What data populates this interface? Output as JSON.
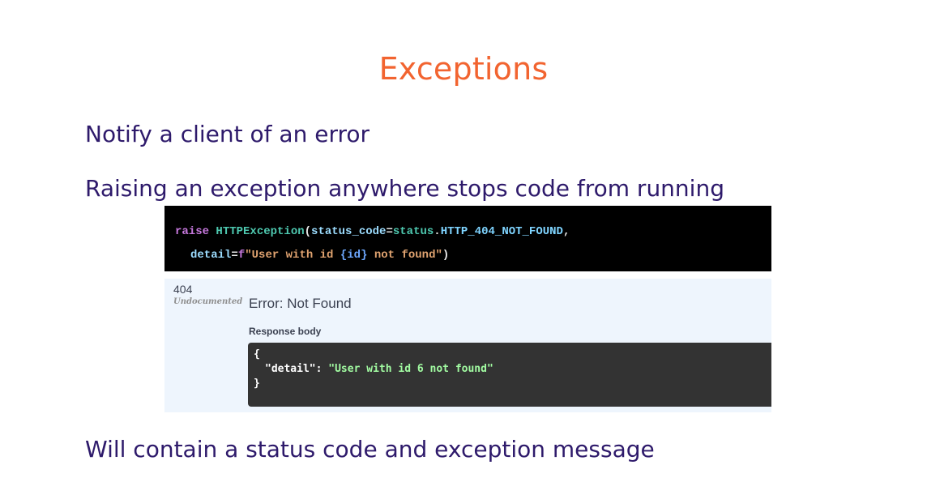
{
  "slide": {
    "title": "Exceptions",
    "bullets": [
      "Notify a client of an error",
      "Raising an exception anywhere stops code from running",
      "Will contain a status code and exception message"
    ]
  },
  "code": {
    "line1": {
      "keyword": "raise",
      "class_name": "HTTPException",
      "open_paren": "(",
      "param": "status_code",
      "equals": "=",
      "module": "status",
      "dot": ".",
      "constant": "HTTP_404_NOT_FOUND",
      "comma": ","
    },
    "line2": {
      "param": "detail",
      "equals": "=",
      "prefix": "f",
      "str_start": "\"User with id ",
      "interp": "{id}",
      "str_end": " not found\"",
      "close_paren": ")"
    }
  },
  "response": {
    "status_code": "404",
    "documentation_tag": "Undocumented",
    "error_message": "Error: Not Found",
    "body_label": "Response body",
    "json": {
      "open_brace": "{",
      "key": "\"detail\"",
      "colon": ": ",
      "value": "\"User with id 6 not found\"",
      "close_brace": "}"
    }
  }
}
